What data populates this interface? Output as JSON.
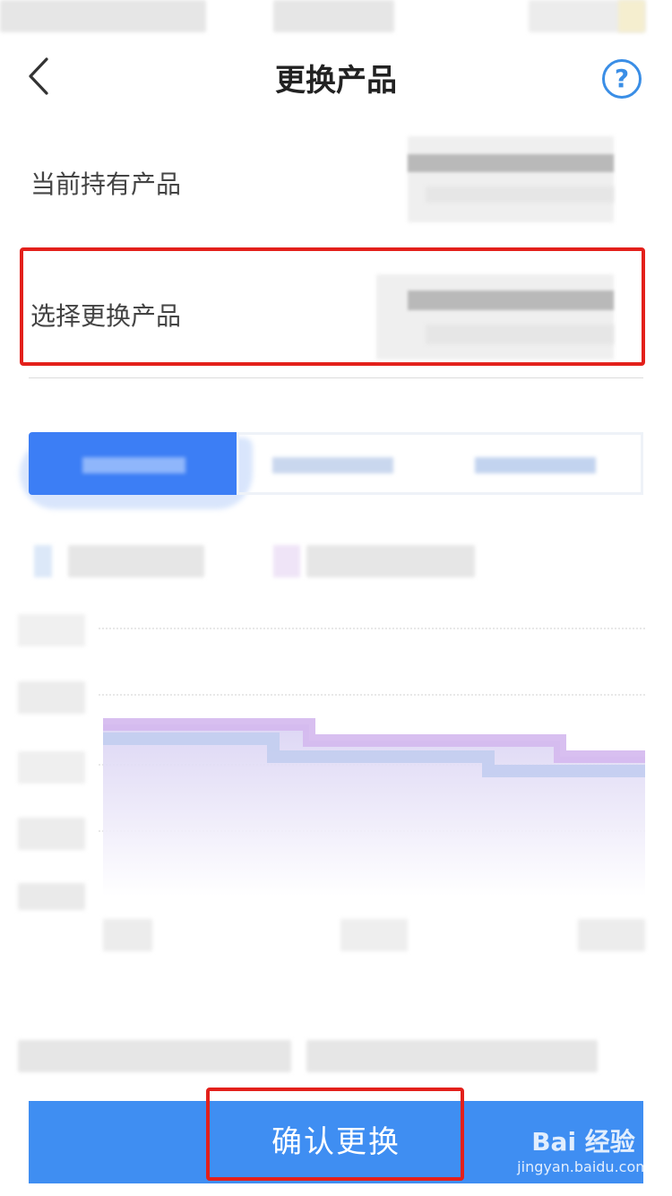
{
  "header": {
    "title": "更换产品",
    "help_icon": "?"
  },
  "rows": {
    "current_product_label": "当前持有产品",
    "select_product_label": "选择更换产品"
  },
  "footer": {
    "confirm_label": "确认更换"
  },
  "watermark": {
    "brand": "Bai 经验",
    "url": "jingyan.baidu.com"
  },
  "colors": {
    "accent": "#3f8ef2",
    "highlight": "#e3201b",
    "tab_active": "#3c7ef5"
  }
}
